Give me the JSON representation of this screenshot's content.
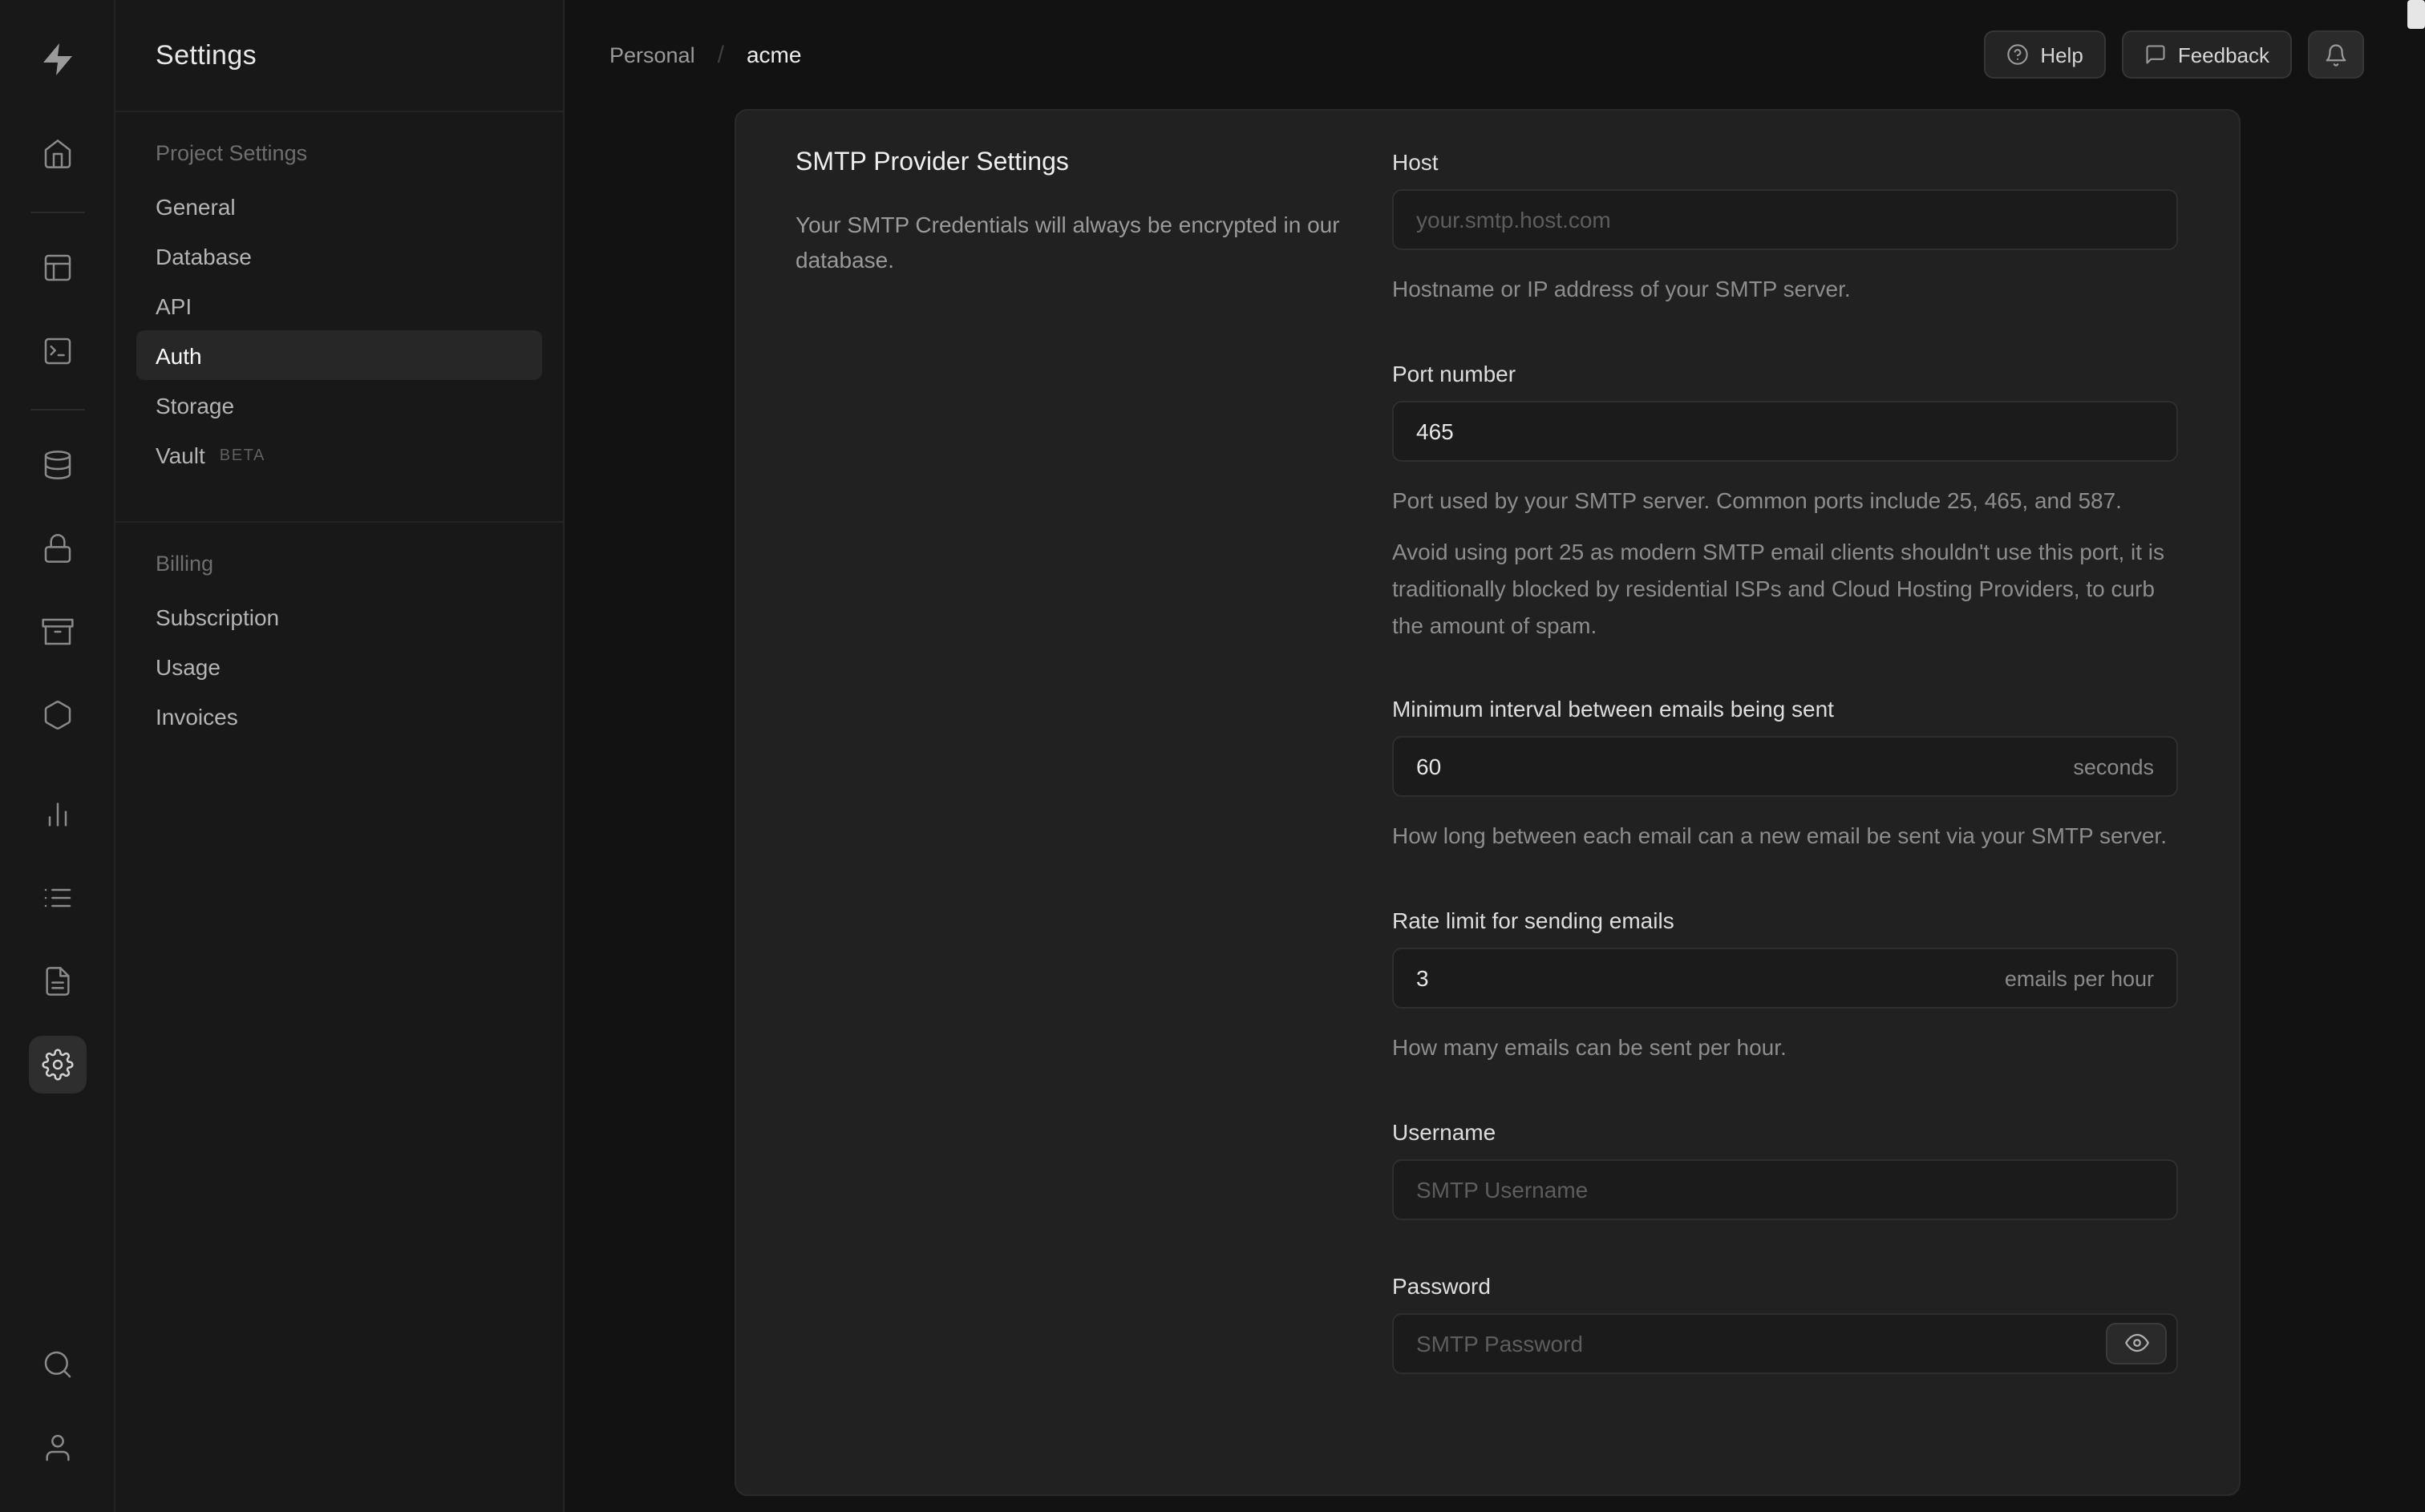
{
  "app": {
    "background": "#121212",
    "panel_background": "#212121",
    "sidebar_background": "#181818"
  },
  "rail": {
    "icons": [
      "supabase-logo",
      "home",
      "table-editor",
      "sql-editor",
      "database",
      "auth",
      "storage",
      "edge-functions",
      "reports",
      "logs",
      "api-docs",
      "project-settings",
      "search",
      "account"
    ],
    "active": "project-settings"
  },
  "sidebar": {
    "title": "Settings",
    "sections": [
      {
        "heading": "Project Settings",
        "items": [
          {
            "label": "General"
          },
          {
            "label": "Database"
          },
          {
            "label": "API"
          },
          {
            "label": "Auth",
            "active": true
          },
          {
            "label": "Storage"
          },
          {
            "label": "Vault",
            "badge": "BETA"
          }
        ]
      },
      {
        "heading": "Billing",
        "items": [
          {
            "label": "Subscription"
          },
          {
            "label": "Usage"
          },
          {
            "label": "Invoices"
          }
        ]
      }
    ]
  },
  "header": {
    "breadcrumb": {
      "org": "Personal",
      "separator": "/",
      "project": "acme"
    },
    "buttons": {
      "help": "Help",
      "feedback": "Feedback",
      "notifications_icon": "bell-icon"
    }
  },
  "smtp": {
    "title": "SMTP Provider Settings",
    "description": "Your SMTP Credentials will always be encrypted in our database.",
    "host": {
      "label": "Host",
      "placeholder": "your.smtp.host.com",
      "help": "Hostname or IP address of your SMTP server."
    },
    "port": {
      "label": "Port number",
      "value": "465",
      "help": "Port used by your SMTP server. Common ports include 25, 465, and 587.",
      "note": "Avoid using port 25 as modern SMTP email clients shouldn't use this port, it is traditionally blocked by residential ISPs and Cloud Hosting Providers, to curb the amount of spam."
    },
    "interval": {
      "label": "Minimum interval between emails being sent",
      "value": "60",
      "suffix": "seconds",
      "help": "How long between each email can a new email be sent via your SMTP server."
    },
    "rate": {
      "label": "Rate limit for sending emails",
      "value": "3",
      "suffix": "emails per hour",
      "help": "How many emails can be sent per hour."
    },
    "username": {
      "label": "Username",
      "placeholder": "SMTP Username"
    },
    "password": {
      "label": "Password",
      "placeholder": "SMTP Password"
    }
  }
}
